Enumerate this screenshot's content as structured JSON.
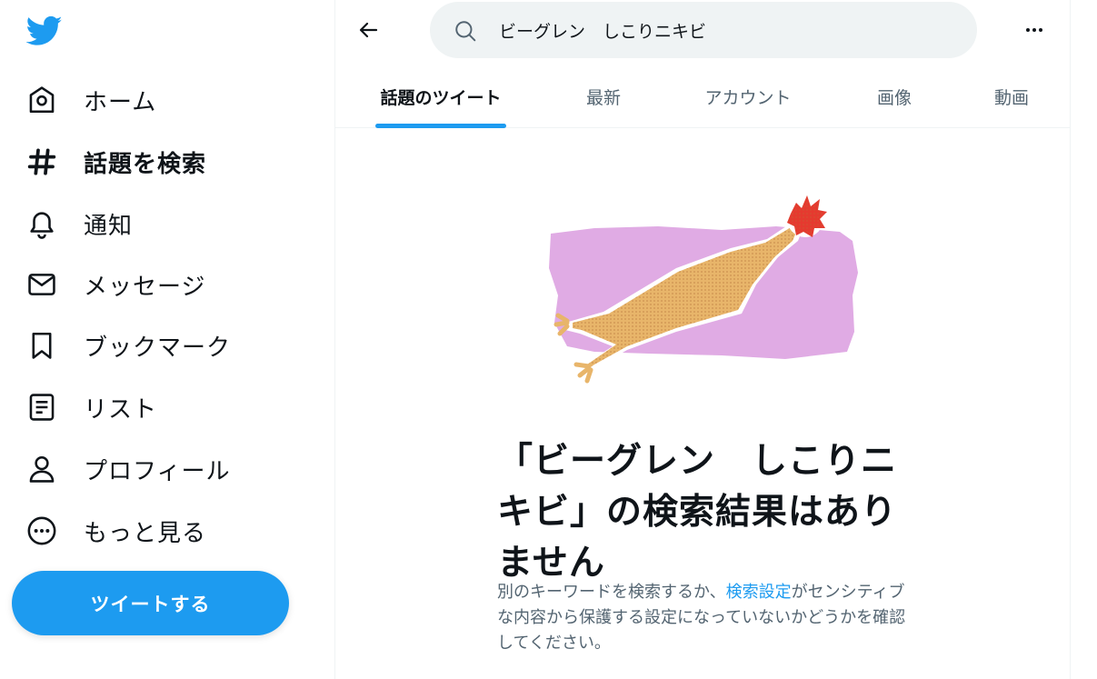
{
  "sidebar": {
    "logo_icon": "twitter-bird-icon",
    "items": [
      {
        "label": "ホーム",
        "icon": "home-icon",
        "active": false
      },
      {
        "label": "話題を検索",
        "icon": "hashtag-icon",
        "active": true
      },
      {
        "label": "通知",
        "icon": "bell-icon",
        "active": false
      },
      {
        "label": "メッセージ",
        "icon": "envelope-icon",
        "active": false
      },
      {
        "label": "ブックマーク",
        "icon": "bookmark-icon",
        "active": false
      },
      {
        "label": "リスト",
        "icon": "list-icon",
        "active": false
      },
      {
        "label": "プロフィール",
        "icon": "person-icon",
        "active": false
      },
      {
        "label": "もっと見る",
        "icon": "more-circle-icon",
        "active": false
      }
    ],
    "tweet_button": "ツイートする"
  },
  "header": {
    "search_value": "ビーグレン　しこりニキビ"
  },
  "tabs": [
    {
      "label": "話題のツイート",
      "active": true
    },
    {
      "label": "最新",
      "active": false
    },
    {
      "label": "アカウント",
      "active": false
    },
    {
      "label": "画像",
      "active": false
    },
    {
      "label": "動画",
      "active": false
    }
  ],
  "empty_state": {
    "title": "「ビーグレン　しこりニキビ」の検索結果はありません",
    "desc_before": "別のキーワードを検索するか、",
    "desc_link": "検索設定",
    "desc_after": "がセンシティブな内容から保護する設定になっていないかどうかを確認してください。"
  },
  "colors": {
    "accent": "#1d9bf0",
    "text_primary": "#0f1419",
    "text_secondary": "#536471",
    "search_bg": "#eff3f4"
  }
}
